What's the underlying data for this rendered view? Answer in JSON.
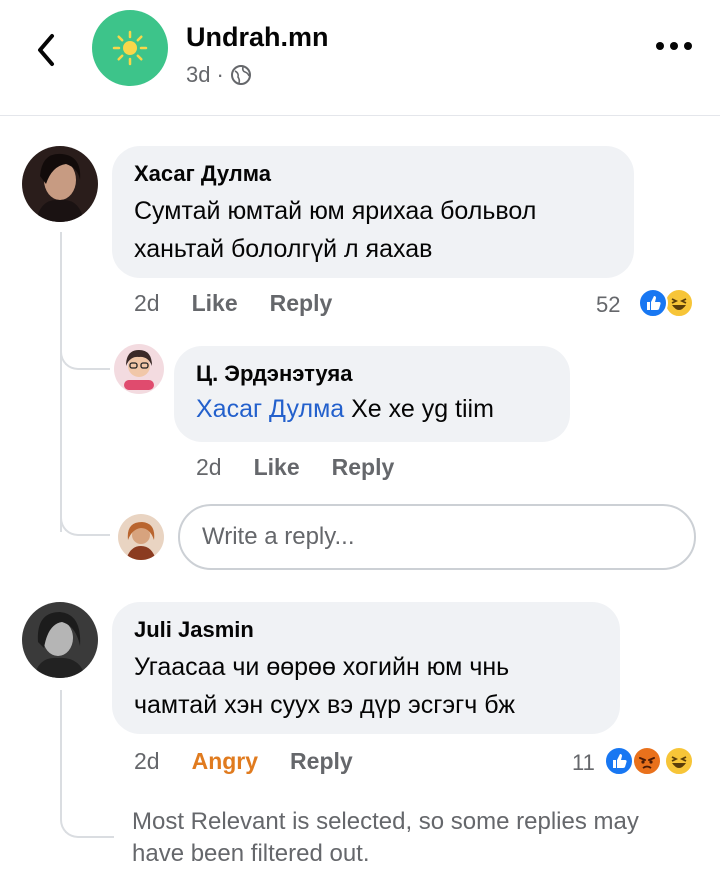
{
  "header": {
    "page_name": "Undrah.mn",
    "time": "3d",
    "dot": "·"
  },
  "comments": [
    {
      "author": "Хасаг Дулма",
      "text_line1": "Сумтай юмтай юм ярихаа больвол",
      "text_line2": "ханьтай бололгүй л яахав",
      "time": "2d",
      "like": "Like",
      "reply": "Reply",
      "reaction_count": "52",
      "replies": [
        {
          "author": "Ц. Эрдэнэтуяа",
          "mention": "Хасаг Дулма",
          "text": " Хе хе yg tiim",
          "time": "2d",
          "like": "Like",
          "reply": "Reply"
        }
      ],
      "reply_placeholder": "Write a reply..."
    },
    {
      "author": "Juli Jasmin",
      "text_line1": "Угаасаа чи өөрөө хогийн юм чнь",
      "text_line2": "чамтай хэн суух вэ дүр эсгэгч бж",
      "time": "2d",
      "reaction_label": "Angry",
      "reply": "Reply",
      "reaction_count": "11"
    }
  ],
  "footer_note": "Most Relevant is selected, so some replies may have been filtered out.",
  "colors": {
    "like_blue": "#1877f2",
    "haha_yellow": "#f7c538",
    "angry_orange": "#e07b1f",
    "mention_blue": "#2360cc"
  }
}
